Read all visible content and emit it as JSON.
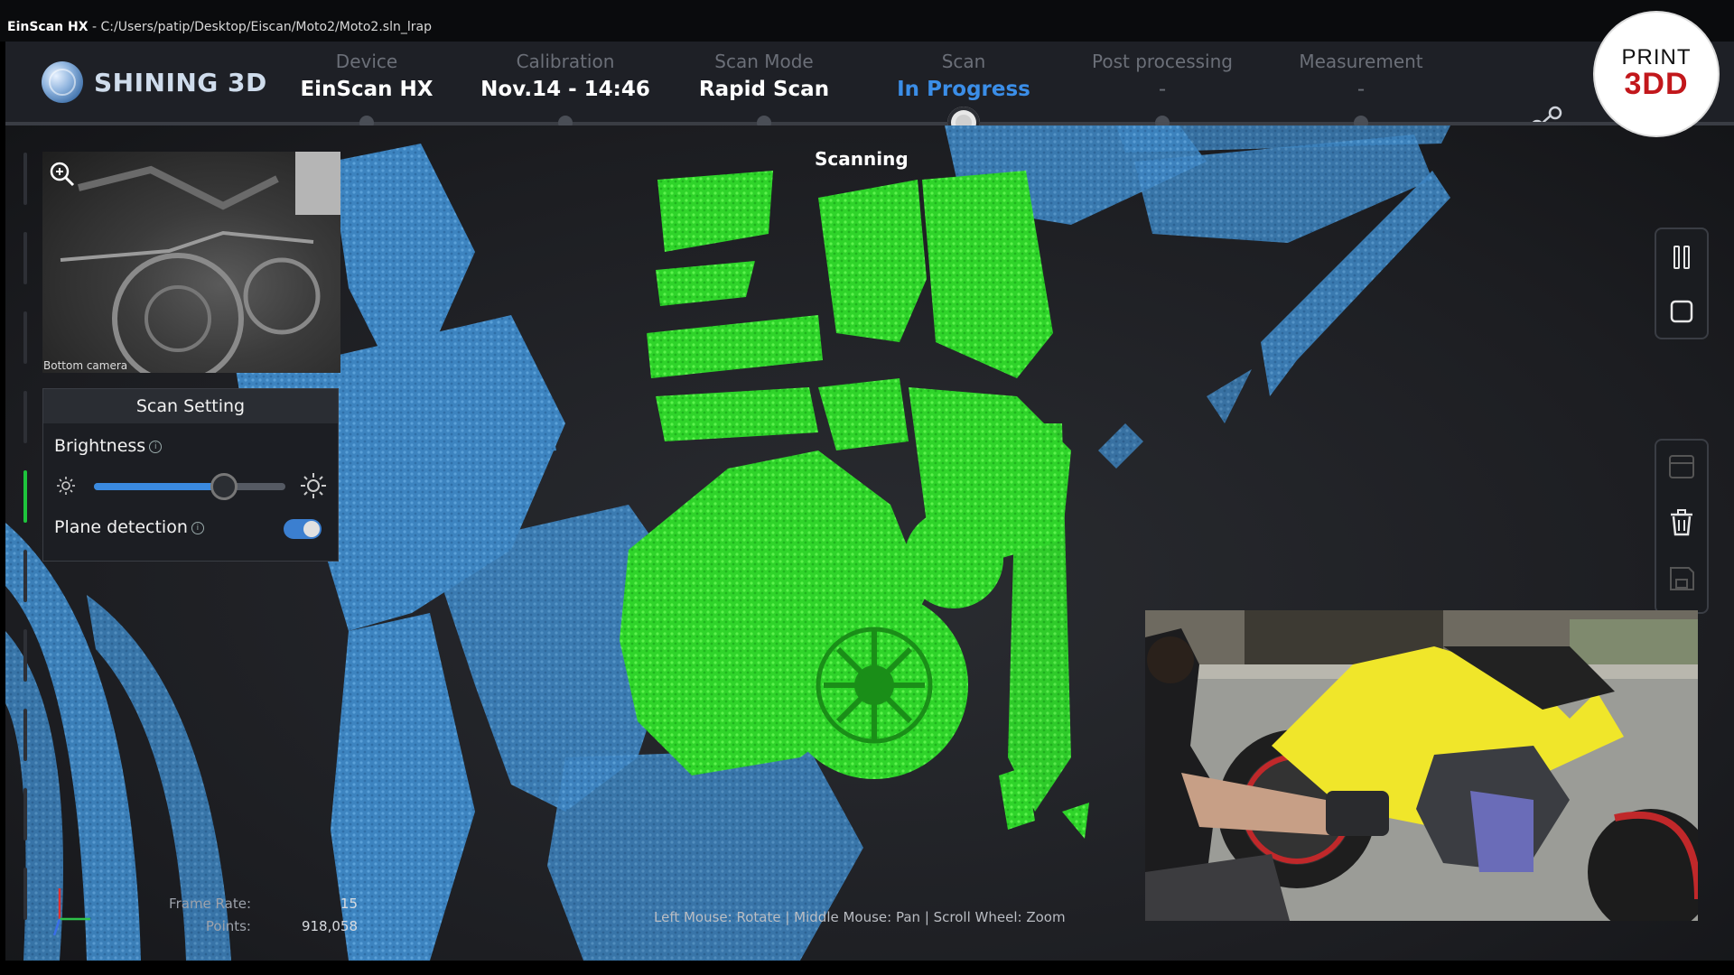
{
  "window": {
    "app_name": "EinScan HX",
    "separator": "-",
    "file_path": "C:/Users/patip/Desktop/Eiscan/Moto2/Moto2.sln_lrap"
  },
  "header": {
    "brand": "SHINING 3D",
    "steps": [
      {
        "label": "Device",
        "value": "EinScan HX",
        "state": "done"
      },
      {
        "label": "Calibration",
        "value": "Nov.14 - 14:46",
        "state": "done"
      },
      {
        "label": "Scan Mode",
        "value": "Rapid Scan",
        "state": "done"
      },
      {
        "label": "Scan",
        "value": "In Progress",
        "state": "active"
      },
      {
        "label": "Post processing",
        "value": "-",
        "state": "pending"
      },
      {
        "label": "Measurement",
        "value": "-",
        "state": "pending"
      }
    ],
    "share_icon": "share-icon"
  },
  "viewport": {
    "status": "Scanning",
    "camera_caption": "Bottom camera",
    "mouse_hint": "Left Mouse: Rotate | Middle Mouse: Pan | Scroll Wheel: Zoom"
  },
  "scan_setting": {
    "title": "Scan Setting",
    "brightness_label": "Brightness",
    "info_glyph": "i",
    "brightness_level": 0.68,
    "plane_detection_label": "Plane detection",
    "plane_detection_on": true
  },
  "stats": {
    "frame_rate_label": "Frame Rate:",
    "frame_rate_value": "15",
    "points_label": "Points:",
    "points_value": "918,058"
  },
  "toolbar": {
    "pause_icon": "pause-icon",
    "stop_icon": "stop-icon",
    "list_icon": "list-icon",
    "delete_icon": "trash-icon",
    "save_icon": "save-icon"
  },
  "badge": {
    "line1": "PRINT",
    "line2": "3DD"
  },
  "colors": {
    "accent": "#3b8ee8",
    "scan_current": "#2fdb2a",
    "scan_previous": "#3f86c2",
    "badge_red": "#c2171b"
  }
}
